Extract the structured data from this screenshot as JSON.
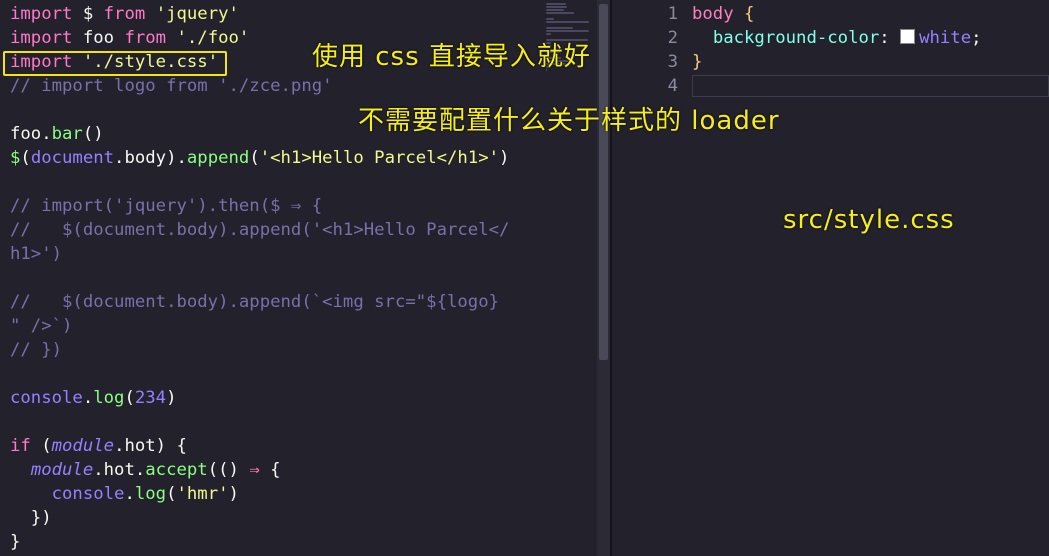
{
  "left_editor": {
    "lines": [
      {
        "segments": [
          {
            "t": "import",
            "c": "kw"
          },
          {
            "t": " $ ",
            "c": "punc"
          },
          {
            "t": "from",
            "c": "kw"
          },
          {
            "t": " ",
            "c": "punc"
          },
          {
            "t": "'jquery'",
            "c": "str"
          }
        ]
      },
      {
        "segments": [
          {
            "t": "import",
            "c": "kw"
          },
          {
            "t": " foo ",
            "c": "punc"
          },
          {
            "t": "from",
            "c": "kw"
          },
          {
            "t": " ",
            "c": "punc"
          },
          {
            "t": "'./foo'",
            "c": "str"
          }
        ]
      },
      {
        "segments": [
          {
            "t": "import",
            "c": "kw"
          },
          {
            "t": " ",
            "c": "punc"
          },
          {
            "t": "'./style.css'",
            "c": "str"
          }
        ]
      },
      {
        "segments": [
          {
            "t": "// import logo from './zce.png'",
            "c": "cmt"
          }
        ]
      },
      {
        "segments": []
      },
      {
        "segments": [
          {
            "t": "foo",
            "c": "punc"
          },
          {
            "t": ".",
            "c": "punc"
          },
          {
            "t": "bar",
            "c": "fn"
          },
          {
            "t": "()",
            "c": "punc"
          }
        ]
      },
      {
        "segments": [
          {
            "t": "$",
            "c": "fn"
          },
          {
            "t": "(",
            "c": "punc"
          },
          {
            "t": "document",
            "c": "var"
          },
          {
            "t": ".",
            "c": "punc"
          },
          {
            "t": "body",
            "c": "punc"
          },
          {
            "t": ").",
            "c": "punc"
          },
          {
            "t": "append",
            "c": "fn"
          },
          {
            "t": "(",
            "c": "punc"
          },
          {
            "t": "'<h1>Hello Parcel</h1>'",
            "c": "str"
          },
          {
            "t": ")",
            "c": "punc"
          }
        ]
      },
      {
        "segments": []
      },
      {
        "segments": [
          {
            "t": "// import('jquery').then($ ⇒ {",
            "c": "cmt"
          }
        ]
      },
      {
        "segments": [
          {
            "t": "//   $(document.body).append('<h1>Hello Parcel</",
            "c": "cmt"
          }
        ]
      },
      {
        "segments": [
          {
            "t": "h1>')",
            "c": "cmt"
          }
        ]
      },
      {
        "segments": []
      },
      {
        "segments": [
          {
            "t": "//   $(document.body).append(`<img src=\"${logo}",
            "c": "cmt"
          }
        ]
      },
      {
        "segments": [
          {
            "t": "\" />`)",
            "c": "cmt"
          }
        ]
      },
      {
        "segments": [
          {
            "t": "// })",
            "c": "cmt"
          }
        ]
      },
      {
        "segments": []
      },
      {
        "segments": [
          {
            "t": "console",
            "c": "var"
          },
          {
            "t": ".",
            "c": "punc"
          },
          {
            "t": "log",
            "c": "fn"
          },
          {
            "t": "(",
            "c": "punc"
          },
          {
            "t": "234",
            "c": "num"
          },
          {
            "t": ")",
            "c": "punc"
          }
        ]
      },
      {
        "segments": []
      },
      {
        "segments": [
          {
            "t": "if",
            "c": "kw"
          },
          {
            "t": " (",
            "c": "punc"
          },
          {
            "t": "module",
            "c": "var ital"
          },
          {
            "t": ".hot) ",
            "c": "punc"
          },
          {
            "t": "{",
            "c": "punc"
          }
        ]
      },
      {
        "segments": [
          {
            "t": "  ",
            "c": "punc"
          },
          {
            "t": "module",
            "c": "var ital"
          },
          {
            "t": ".hot.",
            "c": "punc"
          },
          {
            "t": "accept",
            "c": "fn"
          },
          {
            "t": "(() ",
            "c": "punc"
          },
          {
            "t": "⇒",
            "c": "kw"
          },
          {
            "t": " {",
            "c": "punc"
          }
        ]
      },
      {
        "segments": [
          {
            "t": "    ",
            "c": "punc"
          },
          {
            "t": "console",
            "c": "var"
          },
          {
            "t": ".",
            "c": "punc"
          },
          {
            "t": "log",
            "c": "fn"
          },
          {
            "t": "(",
            "c": "punc"
          },
          {
            "t": "'hmr'",
            "c": "str"
          },
          {
            "t": ")",
            "c": "punc"
          }
        ]
      },
      {
        "segments": [
          {
            "t": "  })",
            "c": "punc"
          }
        ]
      },
      {
        "segments": [
          {
            "t": "}",
            "c": "punc"
          }
        ]
      }
    ]
  },
  "right_editor": {
    "line_numbers": [
      "1",
      "2",
      "3",
      "4"
    ],
    "lines": [
      {
        "segments": [
          {
            "t": "body",
            "c": "sel"
          },
          {
            "t": " ",
            "c": "punc"
          },
          {
            "t": "{",
            "c": "brace"
          }
        ]
      },
      {
        "segments": [
          {
            "t": "  ",
            "c": "punc"
          },
          {
            "t": "background-color",
            "c": "prop"
          },
          {
            "t": ": ",
            "c": "punc"
          },
          {
            "t": "__SWATCH__",
            "c": "swatch"
          },
          {
            "t": "white",
            "c": "var"
          },
          {
            "t": ";",
            "c": "punc"
          }
        ]
      },
      {
        "segments": [
          {
            "t": "}",
            "c": "brace"
          }
        ]
      },
      {
        "segments": []
      }
    ]
  },
  "annotations": {
    "css_import": "使用 css 直接导入就好",
    "no_loader": "不需要配置什么关于样式的 loader",
    "file_name": "src/style.css"
  },
  "colors": {
    "annotation": "#f5ee1a",
    "highlight_box": "#f5e50a",
    "swatch": "#ffffff"
  }
}
